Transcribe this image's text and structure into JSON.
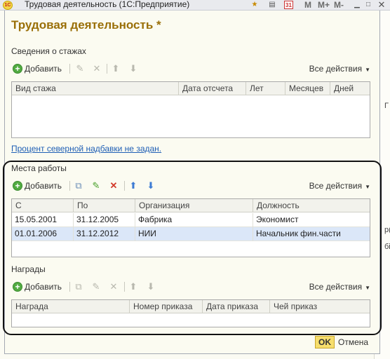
{
  "window": {
    "title": "Трудовая деятельность  (1С:Предприятие)",
    "logo_text": "1C",
    "controls": [
      "M",
      "M+",
      "M-"
    ],
    "calendar_day": "31"
  },
  "form": {
    "title": "Трудовая деятельность *"
  },
  "experience": {
    "section_label": "Сведения о стажах",
    "add_label": "Добавить",
    "all_actions_label": "Все действия",
    "columns": [
      "Вид стажа",
      "Дата отсчета",
      "Лет",
      "Месяцев",
      "Дней"
    ],
    "rows": []
  },
  "northern_link": "Процент северной надбавки не задан.",
  "workplaces": {
    "section_label": "Места работы",
    "add_label": "Добавить",
    "all_actions_label": "Все действия",
    "columns": [
      "С",
      "По",
      "Организация",
      "Должность"
    ],
    "rows": [
      [
        "15.05.2001",
        "31.12.2005",
        "Фабрика",
        "Экономист"
      ],
      [
        "01.01.2006",
        "31.12.2012",
        "НИИ",
        "Начальник фин.части"
      ]
    ]
  },
  "awards": {
    "section_label": "Награды",
    "add_label": "Добавить",
    "all_actions_label": "Все действия",
    "columns": [
      "Награда",
      "Номер приказа",
      "Дата приказа",
      "Чей приказ"
    ],
    "rows": []
  },
  "buttons": {
    "ok": "OK",
    "cancel": "Отмена"
  },
  "background_fragments": [
    "Г",
    "р(",
    "бі"
  ],
  "colors": {
    "form_title": "#9a6f08",
    "link": "#1f5fb5",
    "selected_row": "#dbe7f8",
    "add_icon": "#52ab42",
    "delete_icon": "#d23a2a",
    "edit_icon": "#4aa02c",
    "arrow_icon": "#3d7bd4"
  }
}
